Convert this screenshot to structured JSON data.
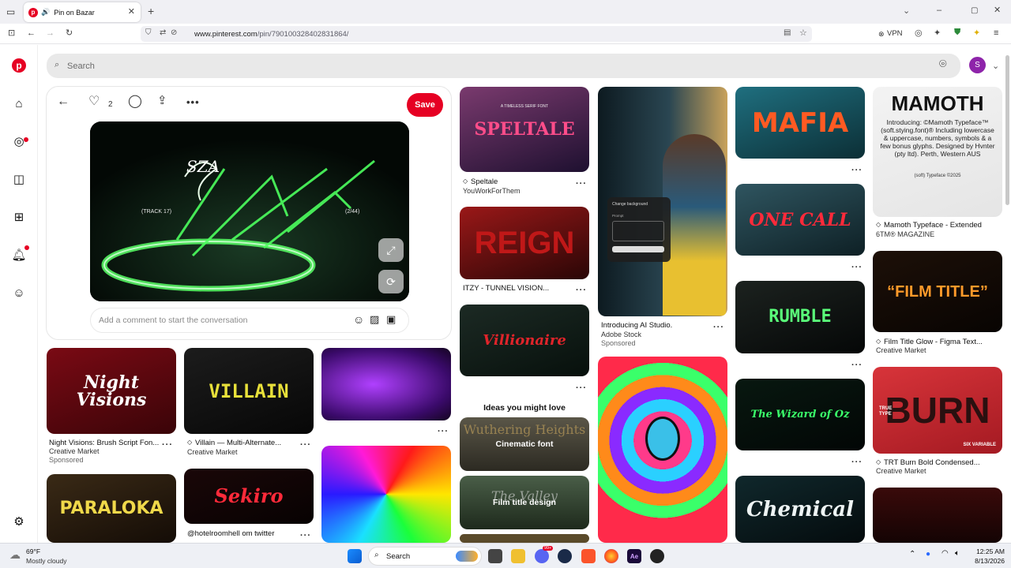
{
  "browser": {
    "tab_title": "Pin on Bazar",
    "url_host": "www.pinterest.com",
    "url_path": "/pin/790100328402831864/",
    "vpn_label": "VPN"
  },
  "search": {
    "placeholder": "Search"
  },
  "profile": {
    "initial": "S"
  },
  "pin": {
    "like_count": "2",
    "save_label": "Save",
    "comment_placeholder": "Add a comment to start the conversation",
    "image_text": {
      "track": "(TRACK 17)",
      "index": "(2/44)"
    }
  },
  "pins": [
    {
      "id": "speltale",
      "image_text": "SPELTALE",
      "image_sub": "A TIMELESS SERIF FONT",
      "title": "Speltale",
      "sub": "YouWorkForThem",
      "colors": [
        "#7a3a6e",
        "#1e1030"
      ]
    },
    {
      "id": "reign",
      "image_text": "REIGN",
      "title": "ITZY - TUNNEL VISION...",
      "colors": [
        "#9a1818",
        "#2a0606"
      ]
    },
    {
      "id": "villionaire",
      "image_text": "Villionaire",
      "colors": [
        "#1c2a24",
        "#07100c"
      ]
    },
    {
      "id": "adobe",
      "title": "Introducing AI Studio.",
      "sub": "Adobe Stock",
      "sponsored": "Sponsored",
      "dialog": {
        "title": "Change background",
        "prompt": "Prompt"
      },
      "colors": [
        "#1f3a4a",
        "#0a1218"
      ]
    },
    {
      "id": "mafia",
      "image_text": "MAFIA",
      "colors": [
        "#1f6f7f",
        "#0c2f36"
      ]
    },
    {
      "id": "onecall",
      "image_text": "ONE CALL",
      "colors": [
        "#2f5560",
        "#0e2025"
      ]
    },
    {
      "id": "rumble",
      "image_text": "RUMBLE",
      "colors": [
        "#1c221f",
        "#050707"
      ]
    },
    {
      "id": "wizardoz",
      "image_text": "The Wizard of Oz",
      "colors": [
        "#081810",
        "#020605"
      ]
    },
    {
      "id": "chemical",
      "image_text": "Chemical",
      "colors": [
        "#10282c",
        "#040b0d"
      ]
    },
    {
      "id": "mamoth",
      "image_text": "MAMOTH",
      "image_sub": "Introducing: ©Mamoth Typeface™ (soft.stying.font)® Including lowercase & uppercase, numbers, symbols & a few bonus glyphs. Designed by Hvnter (pty ltd). Perth, Western AUS",
      "image_tag": "(soft) Typeface  ©2025",
      "title": "Mamoth Typeface - Extended",
      "sub": "6TM® MAGAZINE",
      "colors": [
        "#f3f3f3",
        "#e5e5e5"
      ]
    },
    {
      "id": "filmtitle",
      "image_text": "“FILM TITLE”",
      "title": "Film Title Glow - Figma Text...",
      "sub": "Creative Market",
      "colors": [
        "#1d1008",
        "#080402"
      ]
    },
    {
      "id": "burn",
      "image_text": "BURN",
      "image_sub": "TRUE TYPE",
      "image_tag": "SIX VARIABLE",
      "title": "TRT Burn Bold Condensed...",
      "sub": "Creative Market",
      "colors": [
        "#d8343a",
        "#a41a22"
      ]
    },
    {
      "id": "nightvisions",
      "image_text": "Night Visions",
      "title": "Night Visions: Brush Script Fon...",
      "sub": "Creative Market",
      "sponsored": "Sponsored",
      "colors": [
        "#7a0a14",
        "#3a0408"
      ]
    },
    {
      "id": "villain",
      "image_text": "VILLAIN",
      "title": "Villain — Multi-Alternate...",
      "sub": "Creative Market",
      "colors": [
        "#1c1c1c",
        "#070707"
      ]
    },
    {
      "id": "hotelroom",
      "image_text": "Sekiro",
      "title": "@hotelroomhell om twitter",
      "colors": [
        "#1a0708",
        "#070202"
      ]
    },
    {
      "id": "paraloka",
      "image_text": "PARALOKA",
      "colors": [
        "#3a2a16",
        "#140c06"
      ]
    }
  ],
  "ideas": {
    "heading": "Ideas you might love",
    "items": [
      {
        "label": "Cinematic font",
        "image_text": "Wuthering Heights"
      },
      {
        "label": "Film title design",
        "image_text": "The Valley"
      }
    ]
  },
  "taskbar": {
    "weather_temp": "69°F",
    "weather_desc": "Mostly cloudy",
    "search_label": "Search",
    "time": "12:25 AM",
    "date": "8/13/2026",
    "chat_badge": "99+"
  }
}
